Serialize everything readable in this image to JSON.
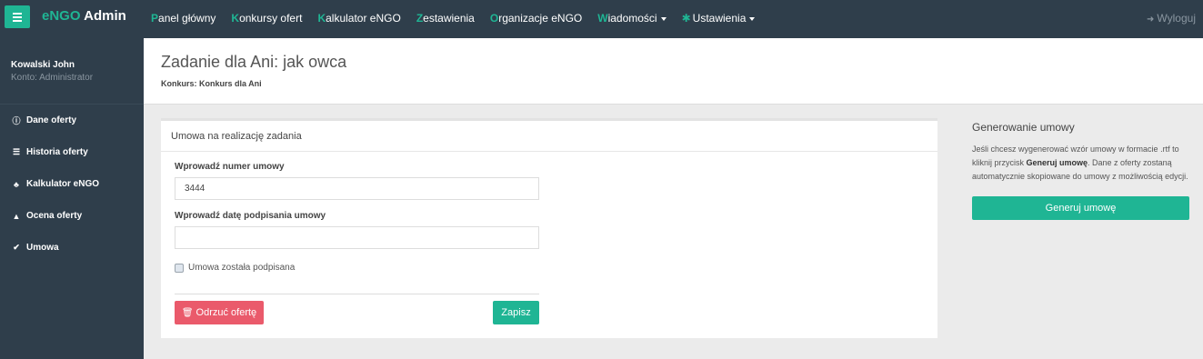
{
  "navbar": {
    "brand_prefix": "eNGO",
    "brand_suffix": " Admin",
    "items": [
      {
        "first": "P",
        "rest": "anel główny"
      },
      {
        "first": "K",
        "rest": "onkursy ofert"
      },
      {
        "first": "K",
        "rest": "alkulator eNGO"
      },
      {
        "first": "Z",
        "rest": "estawienia"
      },
      {
        "first": "O",
        "rest": "rganizacje eNGO"
      },
      {
        "first": "W",
        "rest": "iadomości"
      }
    ],
    "settings_label": "Ustawienia",
    "logout_label": "Wyloguj"
  },
  "sidebar": {
    "user_name": "Kowalski John",
    "user_role": "Konto: Administrator",
    "items": [
      {
        "label": "Dane oferty",
        "icon": "info-icon"
      },
      {
        "label": "Historia oferty",
        "icon": "list-icon"
      },
      {
        "label": "Kalkulator eNGO",
        "icon": "sitemap-icon"
      },
      {
        "label": "Ocena oferty",
        "icon": "graduation-cap-icon"
      },
      {
        "label": "Umowa",
        "icon": "check-circle-icon"
      }
    ]
  },
  "header": {
    "title": "Zadanie dla Ani: jak owca",
    "subtitle": "Konkurs: Konkurs dla Ani"
  },
  "form": {
    "panel_title": "Umowa na realizację zadania",
    "contract_number_label": "Wprowadź numer umowy",
    "contract_number_value": "3444",
    "sign_date_label": "Wprowadź datę podpisania umowy",
    "sign_date_value": "",
    "signed_checkbox_label": "Umowa została podpisana",
    "signed_checked": false,
    "reject_button": "Odrzuć ofertę",
    "save_button": "Zapisz"
  },
  "generate": {
    "title": "Generowanie umowy",
    "text_before": "Jeśli chcesz wygenerować wzór umowy w formacie .rtf to kliknij przycisk ",
    "text_bold": "Generuj umowę",
    "text_after": ". Dane z oferty zostaną automatycznie skopiowane do umowy z możliwością edycji.",
    "button": "Generuj umowę"
  },
  "colors": {
    "accent": "#1fb594",
    "navbar": "#2f3e4b",
    "danger": "#ea5a6b"
  }
}
